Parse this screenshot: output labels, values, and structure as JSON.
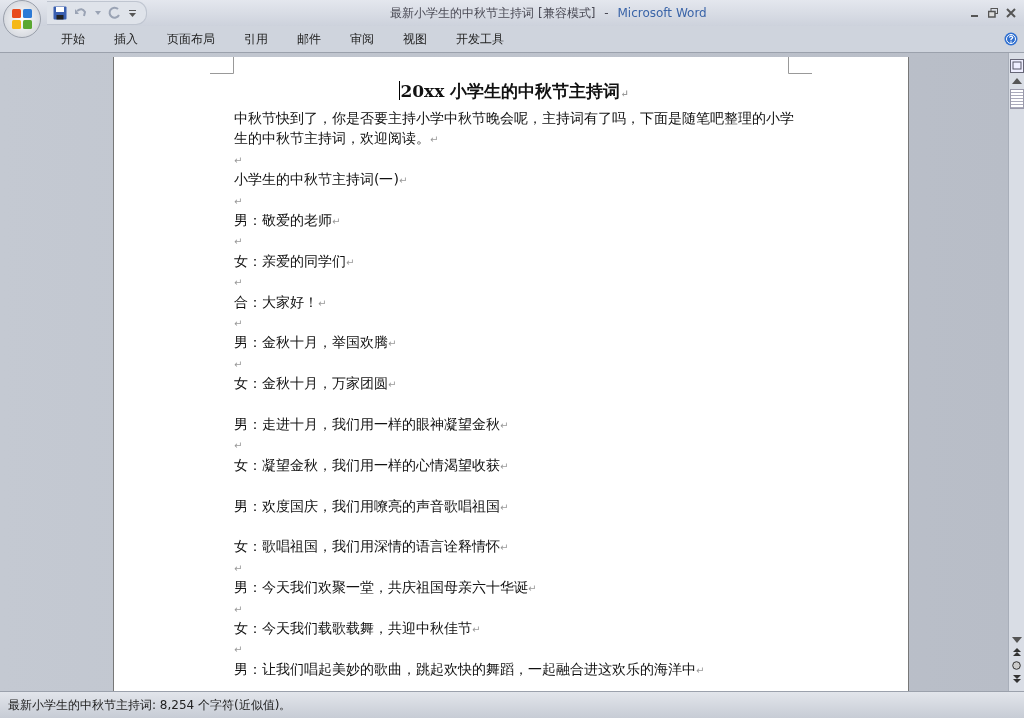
{
  "window": {
    "title": "最新小学生的中秋节主持词 [兼容模式]",
    "separator": "-",
    "app_name": "Microsoft Word"
  },
  "tabs": [
    {
      "label": "开始",
      "selected": false
    },
    {
      "label": "插入",
      "selected": false
    },
    {
      "label": "页面布局",
      "selected": false
    },
    {
      "label": "引用",
      "selected": false
    },
    {
      "label": "邮件",
      "selected": false
    },
    {
      "label": "审阅",
      "selected": false
    },
    {
      "label": "视图",
      "selected": false
    },
    {
      "label": "开发工具",
      "selected": false
    }
  ],
  "document": {
    "paragraphs": [
      {
        "kind": "title",
        "text": "20xx 小学生的中秋节主持词",
        "mark": "↵"
      },
      {
        "kind": "body",
        "text": "中秋节快到了，你是否要主持小学中秋节晚会呢，主持词有了吗，下面是随笔吧整理的小学生的中秋节主持词，欢迎阅读。",
        "mark": "↵"
      },
      {
        "kind": "empty",
        "mark": "↵"
      },
      {
        "kind": "body",
        "text": "小学生的中秋节主持词(一)",
        "mark": "↵"
      },
      {
        "kind": "empty",
        "mark": "↵"
      },
      {
        "kind": "body",
        "text": "男：敬爱的老师",
        "mark": "↵"
      },
      {
        "kind": "empty",
        "mark": "↵"
      },
      {
        "kind": "body",
        "text": "女：亲爱的同学们",
        "mark": "↵"
      },
      {
        "kind": "empty",
        "mark": "↵"
      },
      {
        "kind": "body",
        "text": "合：大家好！",
        "mark": "↵"
      },
      {
        "kind": "empty",
        "mark": "↵"
      },
      {
        "kind": "body",
        "text": "男：金秋十月，举国欢腾",
        "mark": "↵"
      },
      {
        "kind": "empty",
        "mark": "↵"
      },
      {
        "kind": "body",
        "text": "女：金秋十月，万家团圆",
        "mark": "↵"
      },
      {
        "kind": "empty"
      },
      {
        "kind": "body",
        "text": "男：走进十月，我们用一样的眼神凝望金秋",
        "mark": "↵"
      },
      {
        "kind": "empty",
        "mark": "↵"
      },
      {
        "kind": "body",
        "text": "女：凝望金秋，我们用一样的心情渴望收获",
        "mark": "↵"
      },
      {
        "kind": "empty"
      },
      {
        "kind": "body",
        "text": "男：欢度国庆，我们用嘹亮的声音歌唱祖国",
        "mark": "↵"
      },
      {
        "kind": "empty"
      },
      {
        "kind": "body",
        "text": "女：歌唱祖国，我们用深情的语言诠释情怀",
        "mark": "↵"
      },
      {
        "kind": "empty",
        "mark": "↵"
      },
      {
        "kind": "body",
        "text": "男：今天我们欢聚一堂，共庆祖国母亲六十华诞",
        "mark": "↵"
      },
      {
        "kind": "empty",
        "mark": "↵"
      },
      {
        "kind": "body",
        "text": "女：今天我们载歌载舞，共迎中秋佳节",
        "mark": "↵"
      },
      {
        "kind": "empty",
        "mark": "↵"
      },
      {
        "kind": "body",
        "text": "男：让我们唱起美妙的歌曲，跳起欢快的舞蹈，一起融合进这欢乐的海洋中",
        "mark": "↵"
      }
    ]
  },
  "status_bar": {
    "text": "最新小学生的中秋节主持词: 8,254 个字符(近似值)。"
  }
}
